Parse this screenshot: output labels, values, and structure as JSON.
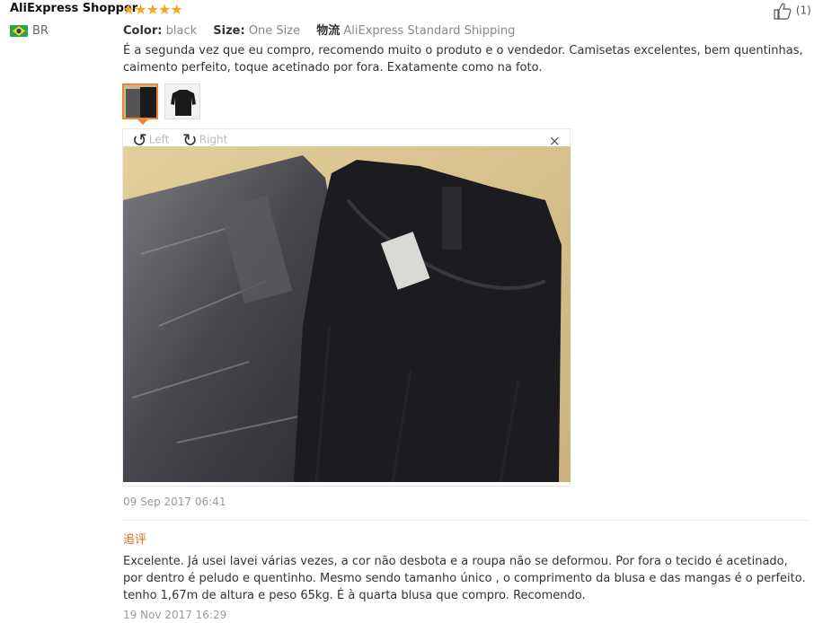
{
  "review": {
    "username": "AliExpress Shopper",
    "rating_stars": 5,
    "stars_text": "★★★★★",
    "country": "BR",
    "likes": "(1)",
    "attributes": {
      "color_label": "Color:",
      "color_value": "black",
      "size_label": "Size:",
      "size_value": "One Size",
      "shipping_label": "物流",
      "shipping_value": "AliExpress Standard Shipping"
    },
    "text": "É a segunda vez que eu compro, recomendo muito o produto e o vendedor. Camisetas excelentes, bem quentinhas, caimento perfeito, toque acetinado por fora. Exatamente como na foto.",
    "viewer": {
      "rotate_left": "Left",
      "rotate_right": "Right",
      "close": "×"
    },
    "date": "09 Sep 2017 06:41",
    "followup_label": "追评",
    "followup_text": "Excelente. Já usei lavei várias vezes, a cor não desbota e a roupa não se deformou. Por fora o tecido é acetinado, por dentro é peludo e quentinho. Mesmo sendo tamanho único , o comprimento da blusa e das mangas é o perfeito. tenho 1,67m de altura e peso 65kg. É à quarta blusa que compro. Recomendo.",
    "followup_date": "19 Nov 2017 16:29"
  },
  "colors": {
    "star": "#f5a623",
    "accent": "#f0842c",
    "followup": "#e46d1f"
  }
}
